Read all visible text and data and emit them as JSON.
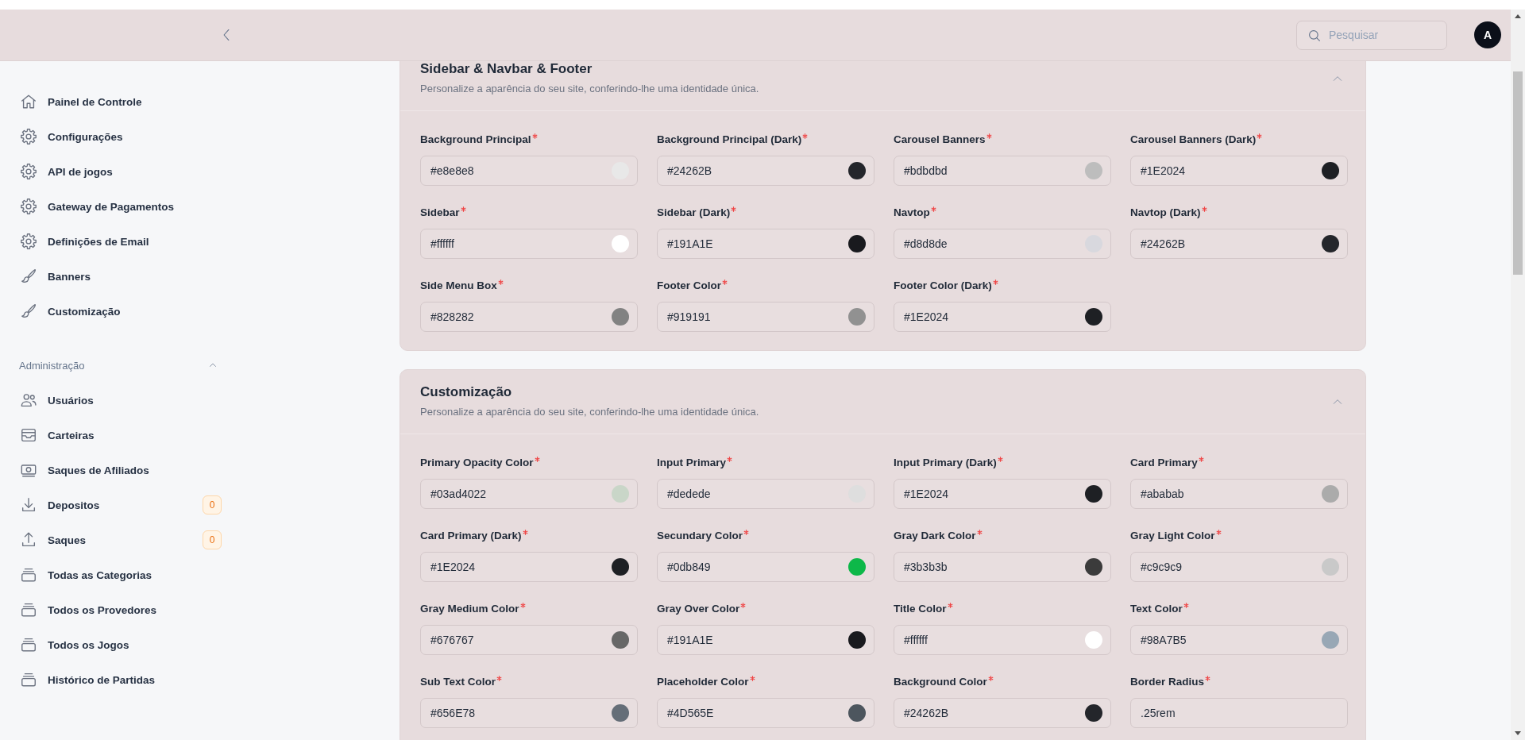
{
  "header": {
    "search": {
      "placeholder": "Pesquisar"
    },
    "avatar": {
      "initial": "A"
    }
  },
  "sidebar": {
    "items": [
      {
        "label": "Painel de Controle"
      },
      {
        "label": "Configurações"
      },
      {
        "label": "API de jogos"
      },
      {
        "label": "Gateway de Pagamentos"
      },
      {
        "label": "Definições de Email"
      },
      {
        "label": "Banners"
      },
      {
        "label": "Customização"
      }
    ],
    "sections": [
      {
        "title": "Administração",
        "expanded": true,
        "items": [
          {
            "label": "Usuários"
          },
          {
            "label": "Carteiras"
          },
          {
            "label": "Saques de Afiliados"
          },
          {
            "label": "Depositos",
            "badge": "0"
          },
          {
            "label": "Saques",
            "badge": "0"
          },
          {
            "label": "Todas as Categorias"
          },
          {
            "label": "Todos os Provedores"
          },
          {
            "label": "Todos os Jogos"
          },
          {
            "label": "Histórico de Partidas"
          }
        ]
      }
    ]
  },
  "cards": [
    {
      "title": "Sidebar & Navbar & Footer",
      "subtitle": "Personalize a aparência do seu site, conferindo-lhe uma identidade única.",
      "expanded": true,
      "fields": [
        {
          "label": "Background Principal",
          "required": true,
          "kind": "color",
          "value": "#e8e8e8",
          "color": "#e8e8e8"
        },
        {
          "label": "Background Principal (Dark)",
          "required": true,
          "kind": "color",
          "value": "#24262B",
          "color": "#24262b"
        },
        {
          "label": "Carousel Banners",
          "required": true,
          "kind": "color",
          "value": "#bdbdbd",
          "color": "#bdbdbd"
        },
        {
          "label": "Carousel Banners (Dark)",
          "required": true,
          "kind": "color",
          "value": "#1E2024",
          "color": "#1e2024"
        },
        {
          "label": "Sidebar",
          "required": true,
          "kind": "color",
          "value": "#ffffff",
          "color": "#ffffff"
        },
        {
          "label": "Sidebar (Dark)",
          "required": true,
          "kind": "color",
          "value": "#191A1E",
          "color": "#191a1e"
        },
        {
          "label": "Navtop",
          "required": true,
          "kind": "color",
          "value": "#d8d8de",
          "color": "#d8d8de"
        },
        {
          "label": "Navtop (Dark)",
          "required": true,
          "kind": "color",
          "value": "#24262B",
          "color": "#24262b"
        },
        {
          "label": "Side Menu Box",
          "required": true,
          "kind": "color",
          "value": "#828282",
          "color": "#828282"
        },
        {
          "label": "Footer Color",
          "required": true,
          "kind": "color",
          "value": "#919191",
          "color": "#919191"
        },
        {
          "label": "Footer Color (Dark)",
          "required": true,
          "kind": "color",
          "value": "#1E2024",
          "color": "#1e2024"
        }
      ]
    },
    {
      "title": "Customização",
      "subtitle": "Personalize a aparência do seu site, conferindo-lhe uma identidade única.",
      "expanded": true,
      "fields": [
        {
          "label": "Primary Opacity Color",
          "required": true,
          "kind": "color",
          "value": "#03ad4022",
          "color": "#c9d6c8"
        },
        {
          "label": "Input Primary",
          "required": true,
          "kind": "color",
          "value": "#dedede",
          "color": "#dedede"
        },
        {
          "label": "Input Primary (Dark)",
          "required": true,
          "kind": "color",
          "value": "#1E2024",
          "color": "#1e2024"
        },
        {
          "label": "Card Primary",
          "required": true,
          "kind": "color",
          "value": "#ababab",
          "color": "#ababab"
        },
        {
          "label": "Card Primary (Dark)",
          "required": true,
          "kind": "color",
          "value": "#1E2024",
          "color": "#1e2024"
        },
        {
          "label": "Secundary Color",
          "required": true,
          "kind": "color",
          "value": "#0db849",
          "color": "#0db849"
        },
        {
          "label": "Gray Dark Color",
          "required": true,
          "kind": "color",
          "value": "#3b3b3b",
          "color": "#3b3b3b"
        },
        {
          "label": "Gray Light Color",
          "required": true,
          "kind": "color",
          "value": "#c9c9c9",
          "color": "#c9c9c9"
        },
        {
          "label": "Gray Medium Color",
          "required": true,
          "kind": "color",
          "value": "#676767",
          "color": "#676767"
        },
        {
          "label": "Gray Over Color",
          "required": true,
          "kind": "color",
          "value": "#191A1E",
          "color": "#191a1e"
        },
        {
          "label": "Title Color",
          "required": true,
          "kind": "color",
          "value": "#ffffff",
          "color": "#ffffff"
        },
        {
          "label": "Text Color",
          "required": true,
          "kind": "color",
          "value": "#98A7B5",
          "color": "#98a7b5"
        },
        {
          "label": "Sub Text Color",
          "required": true,
          "kind": "color",
          "value": "#656E78",
          "color": "#656e78"
        },
        {
          "label": "Placeholder Color",
          "required": true,
          "kind": "color",
          "value": "#4D565E",
          "color": "#4d565e"
        },
        {
          "label": "Background Color",
          "required": true,
          "kind": "color",
          "value": "#24262B",
          "color": "#24262b"
        },
        {
          "label": "Border Radius",
          "required": true,
          "kind": "text",
          "value": ".25rem"
        }
      ]
    }
  ]
}
